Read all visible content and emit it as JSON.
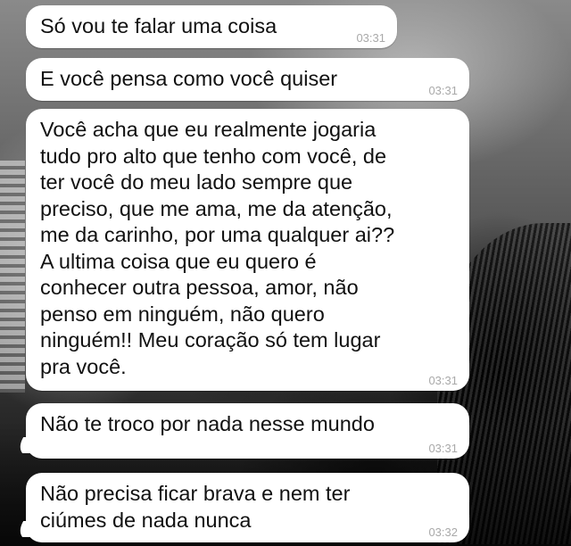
{
  "messages": [
    {
      "text": "Só vou te falar uma coisa",
      "time": "03:31"
    },
    {
      "text": "E você pensa como você quiser",
      "time": "03:31"
    },
    {
      "text": "Você acha que eu realmente jogaria\ntudo pro alto que tenho com você, de\nter você do meu lado sempre que\npreciso, que me ama, me da atenção,\nme da carinho, por uma qualquer ai??\nA ultima coisa que eu quero é\nconhecer outra pessoa, amor, não\npenso em ninguém, não quero\nninguém!! Meu coração só tem lugar\npra você.",
      "time": "03:31"
    },
    {
      "text": "Não te troco por nada nesse mundo",
      "time": "03:31"
    },
    {
      "text": "Não precisa ficar brava e nem ter\nciúmes de nada nunca",
      "time": "03:32"
    }
  ],
  "colors": {
    "bubble": "#ffffff",
    "text": "#111111",
    "timestamp": "#a9a9a9"
  }
}
